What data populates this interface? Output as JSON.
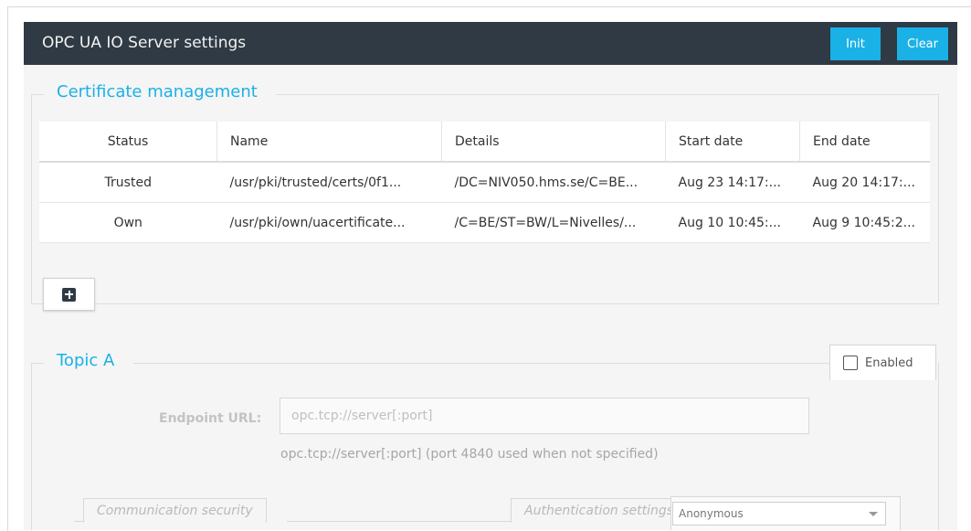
{
  "header": {
    "title": "OPC UA IO Server settings",
    "init_label": "Init",
    "clear_label": "Clear"
  },
  "certificates": {
    "legend": "Certificate management",
    "columns": [
      "Status",
      "Name",
      "Details",
      "Start date",
      "End date"
    ],
    "rows": [
      [
        "Trusted",
        "/usr/pki/trusted/certs/0f1...",
        "/DC=NIV050.hms.se/C=BE...",
        "Aug 23 14:17:...",
        "Aug 20 14:17:..."
      ],
      [
        "Own",
        "/usr/pki/own/uacertificate...",
        "/C=BE/ST=BW/L=Nivelles/...",
        "Aug 10 10:45:...",
        "Aug 9 10:45:2..."
      ]
    ]
  },
  "topic": {
    "legend": "Topic A",
    "enabled_label": "Enabled",
    "enabled": false,
    "endpoint_label": "Endpoint URL:",
    "endpoint_placeholder": "opc.tcp://server[:port]",
    "endpoint_help": "opc.tcp://server[:port] (port 4840 used when not specified)",
    "communication_security_label": "Communication security",
    "authentication_settings_label": "Authentication settings",
    "authentication_value": "Anonymous"
  },
  "colors": {
    "header_bg": "#2f3a44",
    "accent": "#1ab1e6",
    "panel_bg": "#f5f5f5"
  }
}
